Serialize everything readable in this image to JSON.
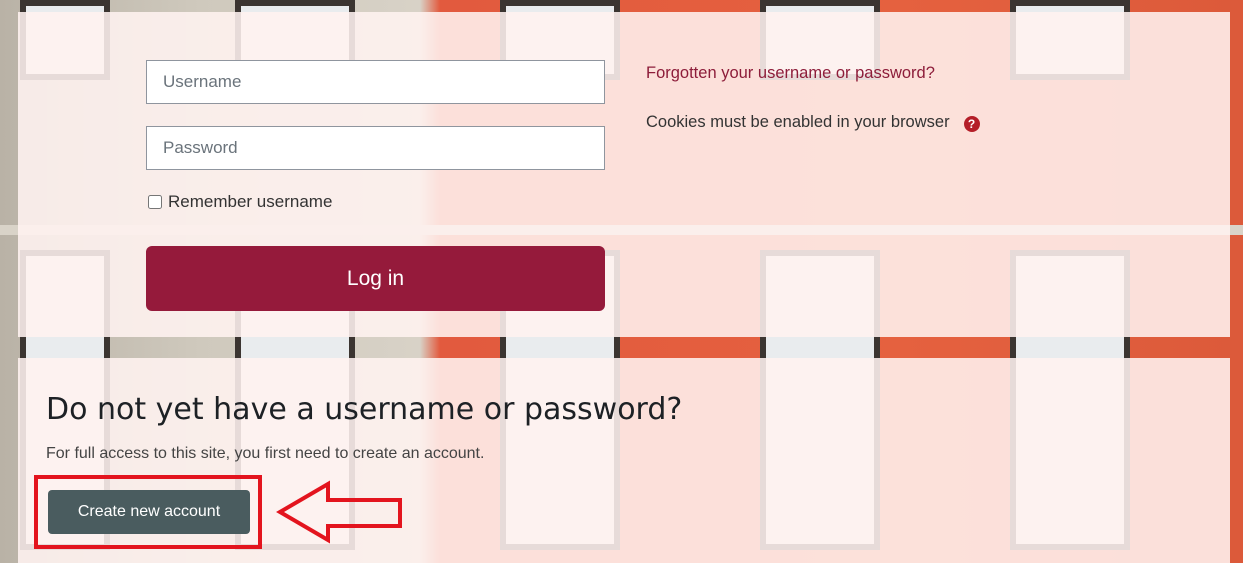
{
  "login": {
    "username_placeholder": "Username",
    "password_placeholder": "Password",
    "remember_label": "Remember username",
    "login_button_label": "Log in",
    "forgot_link": "Forgotten your username or password?",
    "cookies_text": "Cookies must be enabled in your browser",
    "help_icon": "question-circle-icon"
  },
  "signup": {
    "title": "Do not yet have a username or password?",
    "description": "For full access to this site, you first need to create an account.",
    "create_button_label": "Create new account"
  },
  "annotation": {
    "highlight_color": "#e3141e",
    "arrow_icon": "left-arrow-outline-icon"
  },
  "colors": {
    "primary_button": "#951a3b",
    "secondary_button": "#4a5c5f",
    "link": "#8d1d3a"
  }
}
